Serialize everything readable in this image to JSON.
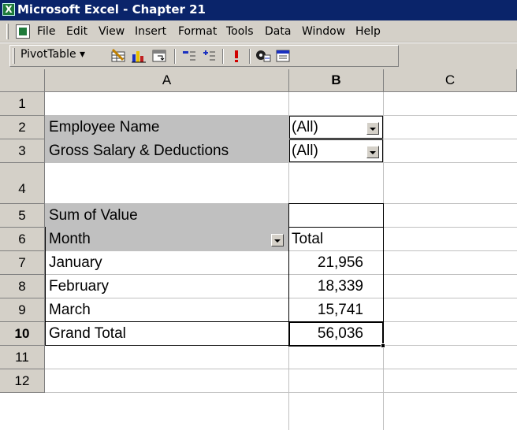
{
  "window": {
    "title": "Microsoft Excel - Chapter 21"
  },
  "menu": {
    "items": [
      "File",
      "Edit",
      "View",
      "Insert",
      "Format",
      "Tools",
      "Data",
      "Window",
      "Help"
    ]
  },
  "toolbar": {
    "pivot_label": "PivotTable ▾",
    "icons": [
      "format-report-icon",
      "chart-wizard-icon",
      "pivot-wizard-icon",
      "hide-detail-icon",
      "show-detail-icon",
      "refresh-data-icon",
      "field-settings-icon",
      "show-field-list-icon"
    ]
  },
  "grid": {
    "columns": [
      "A",
      "B",
      "C"
    ],
    "rows": [
      "1",
      "2",
      "3",
      "4",
      "5",
      "6",
      "7",
      "8",
      "9",
      "10",
      "11",
      "12"
    ]
  },
  "pivot": {
    "page_fields": [
      {
        "label": "Employee Name",
        "value": "(All)"
      },
      {
        "label": "Gross Salary & Deductions",
        "value": "(All)"
      }
    ],
    "data_label": "Sum of Value",
    "row_field": "Month",
    "col_total": "Total",
    "rows": [
      {
        "label": "January",
        "value": "21,956"
      },
      {
        "label": "February",
        "value": "18,339"
      },
      {
        "label": "March",
        "value": "15,741"
      }
    ],
    "grand_total": {
      "label": "Grand Total",
      "value": "56,036"
    }
  }
}
